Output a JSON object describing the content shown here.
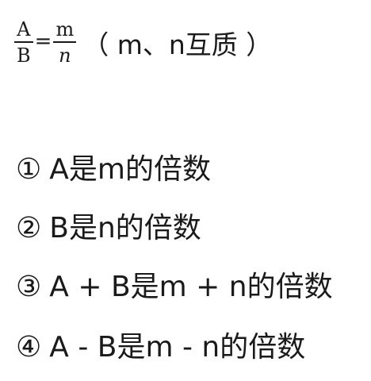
{
  "formula": {
    "left_numerator": "A",
    "left_denominator": "B",
    "equals": "=",
    "right_numerator": "m",
    "right_denominator": "n",
    "note": "（ m、n互质 ）"
  },
  "items": [
    {
      "marker": "①",
      "text": "A是m的倍数"
    },
    {
      "marker": "②",
      "text": "B是n的倍数"
    },
    {
      "marker": "③",
      "text": "A + B是m + n的倍数"
    },
    {
      "marker": "④",
      "text": "A - B是m - n的倍数"
    }
  ]
}
